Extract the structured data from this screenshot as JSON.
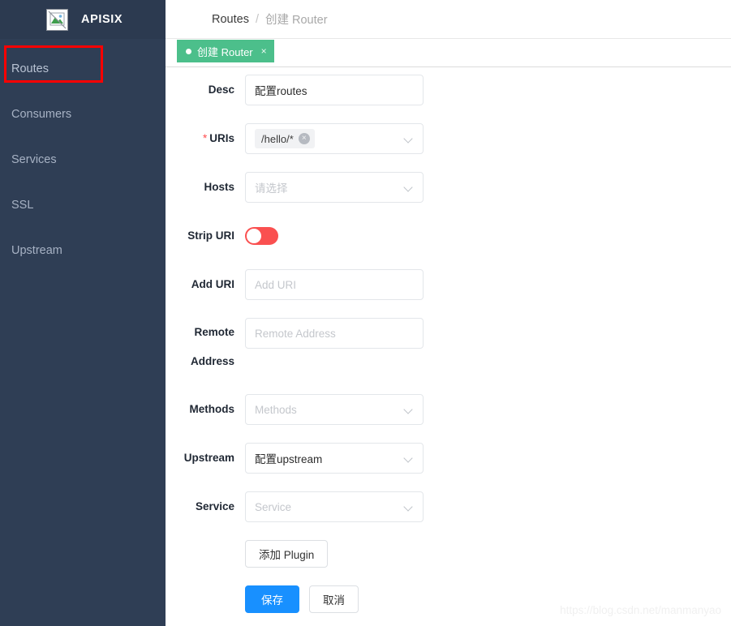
{
  "sidebar": {
    "brand": {
      "name": "APISIX",
      "logo_icon": "broken-image-icon"
    },
    "items": [
      {
        "label": "Routes",
        "active": true
      },
      {
        "label": "Consumers",
        "active": false
      },
      {
        "label": "Services",
        "active": false
      },
      {
        "label": "SSL",
        "active": false
      },
      {
        "label": "Upstream",
        "active": false
      }
    ],
    "background_color": "#2f3e55",
    "annotation_color": "#fe0000"
  },
  "breadcrumb": {
    "root": "Routes",
    "separator": "/",
    "current": "创建 Router"
  },
  "tabs": [
    {
      "label": "创建 Router",
      "close": "×",
      "active": true,
      "color": "#4cbf8b"
    }
  ],
  "form": {
    "fields": [
      {
        "label": "Desc",
        "type": "input",
        "value": "配置routes",
        "placeholder": "",
        "required": false
      },
      {
        "label": "URIs",
        "type": "select-tags",
        "required": true,
        "required_mark": "*",
        "tags": [
          {
            "text": "/hello/*",
            "close": "×"
          }
        ],
        "placeholder": ""
      },
      {
        "label": "Hosts",
        "type": "select",
        "value": "",
        "placeholder": "请选择",
        "required": false
      },
      {
        "label": "Strip URI",
        "type": "toggle",
        "checked": false,
        "color": "#fa5050",
        "required": false
      },
      {
        "label": "Add URI",
        "type": "input",
        "value": "",
        "placeholder": "Add URI",
        "required": false
      },
      {
        "label": "Remote Address",
        "type": "input",
        "value": "",
        "placeholder": "Remote Address",
        "required": false
      },
      {
        "label": "Methods",
        "type": "select",
        "value": "",
        "placeholder": "Methods",
        "required": false
      },
      {
        "label": "Upstream",
        "type": "select",
        "value": "配置upstream",
        "placeholder": "",
        "required": false
      },
      {
        "label": "Service",
        "type": "select",
        "value": "",
        "placeholder": "Service",
        "required": false
      }
    ],
    "add_plugin_label": "添加 Plugin",
    "save_label": "保存",
    "cancel_label": "取消"
  },
  "watermark": "https://blog.csdn.net/manmanyao"
}
